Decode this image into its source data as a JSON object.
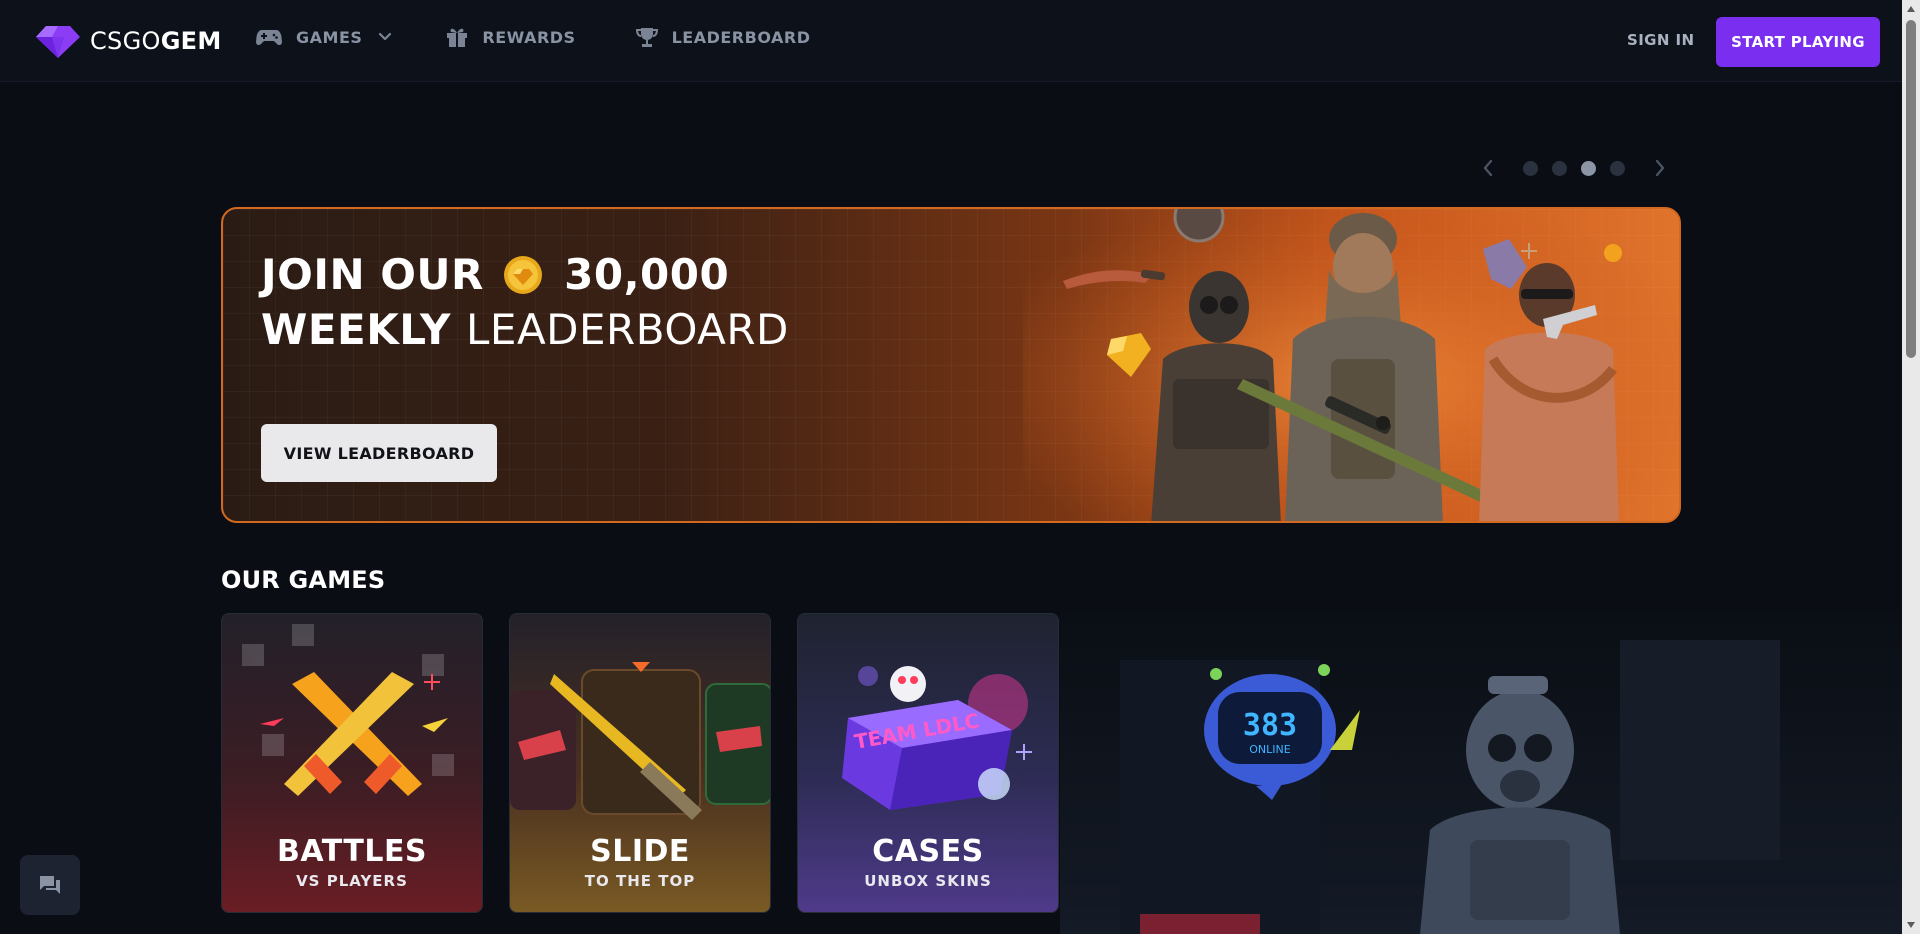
{
  "brand": {
    "logo_light": "CSGO",
    "logo_bold": "GEM",
    "accent": "#7a2ff0"
  },
  "nav": {
    "games_label": "GAMES",
    "rewards_label": "REWARDS",
    "leaderboard_label": "LEADERBOARD"
  },
  "header": {
    "signin_label": "SIGN IN",
    "start_label": "START PLAYING"
  },
  "carousel": {
    "dot_count": 4,
    "active_dot": 3
  },
  "hero": {
    "line1_prefix": "JOIN OUR",
    "line1_amount": "30,000",
    "line2_bold": "WEEKLY",
    "line2_light": "LEADERBOARD",
    "button_label": "VIEW LEADERBOARD",
    "border_color": "#d2691e"
  },
  "games_section": {
    "title": "OUR GAMES",
    "cards": [
      {
        "title": "BATTLES",
        "subtitle": "VS PLAYERS"
      },
      {
        "title": "SLIDE",
        "subtitle": "TO THE TOP"
      },
      {
        "title": "CASES",
        "subtitle": "UNBOX SKINS"
      }
    ],
    "robot_display": "383",
    "robot_status": "ONLINE",
    "case_label": "TEAM LDLC"
  },
  "icons": {
    "logo": "gem-icon",
    "games": "gamepad-icon",
    "rewards": "gift-icon",
    "leaderboard": "trophy-icon",
    "chat": "chat-icon"
  }
}
